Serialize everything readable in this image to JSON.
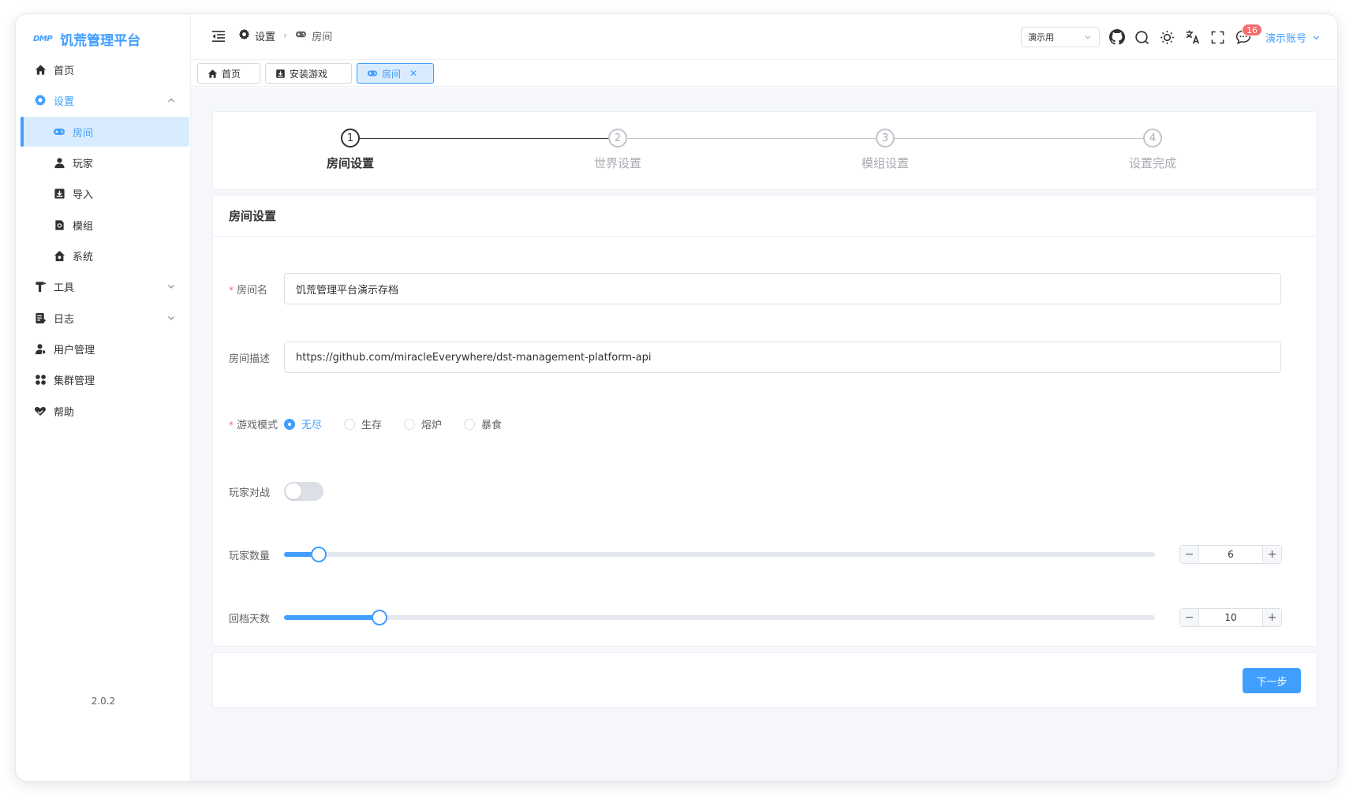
{
  "brand": {
    "logo": "DMP",
    "name": "饥荒管理平台"
  },
  "sidebar": {
    "items": [
      {
        "label": "首页"
      },
      {
        "label": "设置"
      },
      {
        "label": "房间"
      },
      {
        "label": "玩家"
      },
      {
        "label": "导入"
      },
      {
        "label": "模组"
      },
      {
        "label": "系统"
      },
      {
        "label": "工具"
      },
      {
        "label": "日志"
      },
      {
        "label": "用户管理"
      },
      {
        "label": "集群管理"
      },
      {
        "label": "帮助"
      }
    ],
    "version": "2.0.2"
  },
  "header": {
    "breadcrumb": [
      "设置",
      "房间"
    ],
    "select_value": "演示用",
    "notification_count": "16",
    "account": "演示账号"
  },
  "tags": [
    {
      "label": "首页"
    },
    {
      "label": "安装游戏"
    },
    {
      "label": "房间"
    }
  ],
  "steps": [
    {
      "num": "1",
      "title": "房间设置"
    },
    {
      "num": "2",
      "title": "世界设置"
    },
    {
      "num": "3",
      "title": "模组设置"
    },
    {
      "num": "4",
      "title": "设置完成"
    }
  ],
  "form": {
    "title": "房间设置",
    "room_name_label": "房间名",
    "room_name_value": "饥荒管理平台演示存档",
    "room_desc_label": "房间描述",
    "room_desc_value": "https://github.com/miracleEverywhere/dst-management-platform-api",
    "game_mode_label": "游戏模式",
    "game_modes": [
      "无尽",
      "生存",
      "熔炉",
      "暴食"
    ],
    "game_mode_selected": "无尽",
    "pvp_label": "玩家对战",
    "pvp_enabled": false,
    "max_players_label": "玩家数量",
    "max_players_value": "6",
    "max_players_fraction": 0.04,
    "rollback_days_label": "回档天数",
    "rollback_days_value": "10",
    "rollback_days_fraction": 0.11
  },
  "footer": {
    "next_label": "下一步"
  },
  "colors": {
    "primary": "#409eff",
    "danger": "#f56c6c",
    "active_bg": "#d9ecff"
  }
}
